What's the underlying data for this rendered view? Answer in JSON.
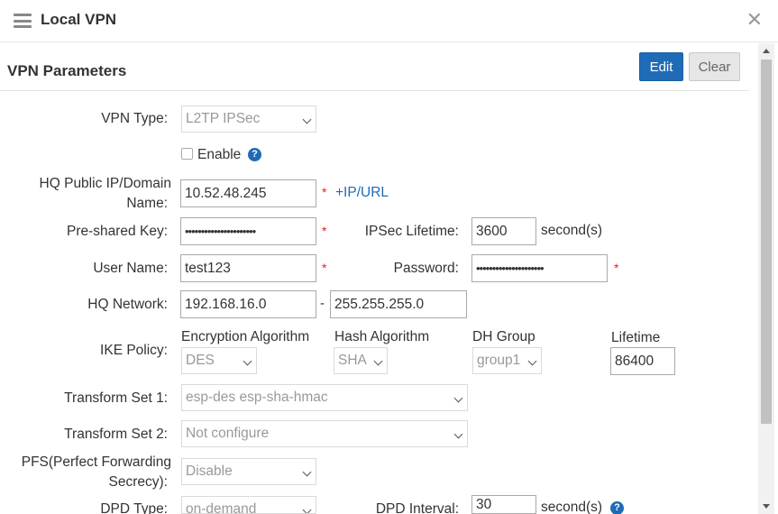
{
  "header": {
    "title": "Local VPN"
  },
  "section": {
    "title": "VPN Parameters",
    "edit_label": "Edit",
    "clear_label": "Clear"
  },
  "form": {
    "vpn_type": {
      "label": "VPN Type:",
      "value": "L2TP IPSec"
    },
    "enable": {
      "label": "Enable",
      "checked": false
    },
    "hq_public_ip": {
      "label_line1": "HQ Public IP/Domain",
      "label_line2": "Name:",
      "value": "10.52.48.245",
      "add_link": "+IP/URL"
    },
    "pre_shared_key": {
      "label": "Pre-shared Key:",
      "value": "••••••••••••••••••••••"
    },
    "ipsec_lifetime": {
      "label": "IPSec Lifetime:",
      "value": "3600",
      "unit": "second(s)"
    },
    "user_name": {
      "label": "User Name:",
      "value": "test123"
    },
    "password": {
      "label": "Password:",
      "value": "•••••••••••••••••••••"
    },
    "hq_network": {
      "label": "HQ Network:",
      "ip": "192.168.16.0",
      "separator": "-",
      "mask": "255.255.255.0"
    },
    "ike_policy": {
      "label": "IKE Policy:",
      "encryption": {
        "label": "Encryption Algorithm",
        "value": "DES"
      },
      "hash": {
        "label": "Hash Algorithm",
        "value": "SHA"
      },
      "dh_group": {
        "label": "DH Group",
        "value": "group1"
      },
      "lifetime": {
        "label": "Lifetime",
        "value": "86400"
      }
    },
    "transform_set_1": {
      "label": "Transform Set 1:",
      "value": "esp-des esp-sha-hmac"
    },
    "transform_set_2": {
      "label": "Transform Set 2:",
      "value": "Not configure"
    },
    "pfs": {
      "label_line1": "PFS(Perfect Forwarding",
      "label_line2": "Secrecy):",
      "value": "Disable"
    },
    "dpd_type": {
      "label": "DPD Type:",
      "value": "on-demand"
    },
    "dpd_interval": {
      "label": "DPD Interval:",
      "value": "30",
      "unit": "second(s)"
    }
  },
  "required_mark": "*",
  "help_glyph": "?",
  "colors": {
    "primary": "#1f6bb5",
    "required": "#e2231a"
  }
}
